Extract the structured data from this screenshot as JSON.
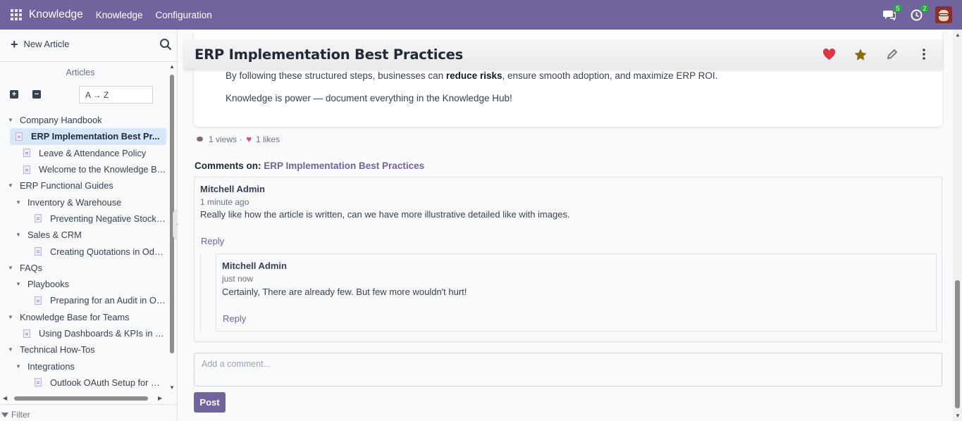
{
  "navbar": {
    "app_title": "Knowledge",
    "menu": [
      "Knowledge",
      "Configuration"
    ],
    "messages_count": "5",
    "activities_count": "2",
    "colors": {
      "bar": "#71639e",
      "badge": "#28a745"
    }
  },
  "sidebar": {
    "new_article_label": "New Article",
    "section_title": "Articles",
    "sort_value": "A → Z",
    "filter_label": "Filter",
    "tree": [
      {
        "label": "Company Handbook",
        "type": "folder",
        "level": 0
      },
      {
        "label": "ERP Implementation Best Pr...",
        "type": "doc",
        "level": 1,
        "active": true
      },
      {
        "label": "Leave & Attendance Policy",
        "type": "doc",
        "level": 1
      },
      {
        "label": "Welcome to the Knowledge Base",
        "type": "doc",
        "level": 1
      },
      {
        "label": "ERP Functional Guides",
        "type": "folder",
        "level": 0
      },
      {
        "label": "Inventory & Warehouse",
        "type": "folder",
        "level": 1
      },
      {
        "label": "Preventing Negative Stock in P...",
        "type": "doc",
        "level": 2
      },
      {
        "label": "Sales & CRM",
        "type": "folder",
        "level": 1
      },
      {
        "label": "Creating Quotations in Odoo S...",
        "type": "doc",
        "level": 2
      },
      {
        "label": "FAQs",
        "type": "folder",
        "level": 0
      },
      {
        "label": "Playbooks",
        "type": "folder",
        "level": 1
      },
      {
        "label": "Preparing for an Audit in Odoo",
        "type": "doc",
        "level": 2
      },
      {
        "label": "Knowledge Base for Teams",
        "type": "folder",
        "level": 0
      },
      {
        "label": "Using Dashboards & KPIs in O...",
        "type": "doc",
        "level": 1
      },
      {
        "label": "Technical How-Tos",
        "type": "folder",
        "level": 0
      },
      {
        "label": "Integrations",
        "type": "folder",
        "level": 1
      },
      {
        "label": "Outlook OAuth Setup for Outg...",
        "type": "doc",
        "level": 2
      }
    ]
  },
  "article": {
    "title": "ERP Implementation Best Practices",
    "para1_pre": "By following these structured steps, businesses can ",
    "para1_bold": "reduce risks",
    "para1_post": ", ensure smooth adoption, and maximize ERP ROI.",
    "para2": "Knowledge is power — document everything in the Knowledge Hub!",
    "views": "1 views ·",
    "likes": "1 likes",
    "colors": {
      "favorite": "#dc3545",
      "star": "#8a6d0b"
    }
  },
  "comments": {
    "heading_prefix": "Comments on:",
    "heading_link": "ERP Implementation Best Practices",
    "items": [
      {
        "author": "Mitchell Admin",
        "time": "1 minute ago",
        "body": "Really like how the article is written, can we have more illustrative detailed like with images.",
        "reply_label": "Reply"
      },
      {
        "author": "Mitchell Admin",
        "time": "just now",
        "body": "Certainly, There are already few. But few more wouldn't hurt!",
        "reply_label": "Reply"
      }
    ],
    "input_placeholder": "Add a comment...",
    "post_label": "Post"
  }
}
